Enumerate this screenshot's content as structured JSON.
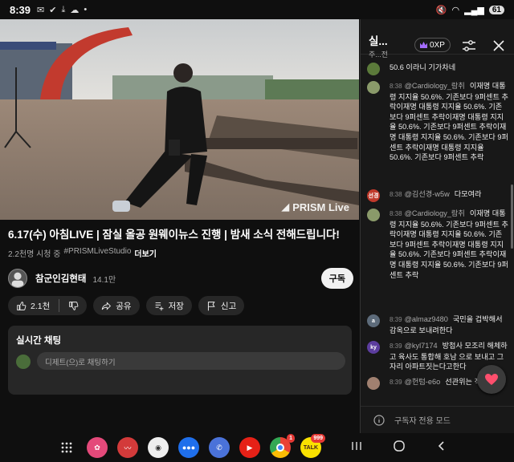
{
  "status_bar": {
    "time": "8:39",
    "battery": "61"
  },
  "video": {
    "watermark": "PRISM Live"
  },
  "video_info": {
    "title": "6.17(수) 아침LIVE | 잠실 올공 원웨이뉴스 진행 | 밤새 소식 전해드립니다!",
    "watching": "2.2천명 시청 중",
    "hashtag": "#PRISMLiveStudio",
    "more_label": "더보기"
  },
  "channel": {
    "name": "참군인김현태",
    "subscribers": "14.1만",
    "subscribe_label": "구독"
  },
  "actions": {
    "likes": "2.1천",
    "share": "공유",
    "save": "저장",
    "report": "신고"
  },
  "live_chat": {
    "label": "실시간 채팅",
    "placeholder": "디제트(으)로 채팅하기"
  },
  "chat_panel": {
    "title": "실...",
    "subtitle": "주...전",
    "xp": "0XP",
    "messages": [
      {
        "time": "",
        "user": "",
        "text": "50.6 이라니 기가차네",
        "avatar_color": "#5b7a3a",
        "avatar_text": ""
      },
      {
        "time": "8:38",
        "user": "@Cardiology_람취",
        "text": "이재명 대통령 지지율 50.6%. 기존보다 9퍼센트 추락이재명 대통령 지지율 50.6%. 기존보다 9퍼센트 추락이재명 대통령 지지율 50.6%. 기존보다 9퍼센트 추락이재명 대통령 지지율 50.6%. 기존보다 9퍼센트 추락이재명 대통령 지지율 50.6%. 기존보다 9퍼센트 추락",
        "avatar_color": "#8a9a6a",
        "avatar_text": ""
      },
      {
        "time": "8:38",
        "user": "@김선경-w5w",
        "text": "다모여라",
        "avatar_color": "#c0392b",
        "avatar_text": "선경"
      },
      {
        "time": "8:38",
        "user": "@Cardiology_람취",
        "text": "이재명 대통령 지지율 50.6%. 기존보다 9퍼센트 추락이재명 대통령 지지율 50.6%. 기존보다 9퍼센트 추락이재명 대통령 지지율 50.6%. 기존보다 9퍼센트 추락이재명 대통령 지지율 50.6%. 기존보다 9퍼센트 추락",
        "avatar_color": "#8a9a6a",
        "avatar_text": ""
      },
      {
        "time": "8:39",
        "user": "@almaz9480",
        "text": "국민을 겁박해서 감옥으로 보내려한다",
        "avatar_color": "#5d6b7a",
        "avatar_text": "a"
      },
      {
        "time": "8:39",
        "user": "@kyl7174",
        "text": "방첩사 모조리 해체하고 육사도 통합해 호남 으로 보내고 그자리 아파트짓는다고한다",
        "avatar_color": "#5c3d9e",
        "avatar_text": "ky"
      },
      {
        "time": "8:39",
        "user": "@헌텀-e6o",
        "text": "선관위는 적입니다",
        "avatar_color": "#a08070",
        "avatar_text": ""
      }
    ],
    "footer": "구독자 전용 모드"
  },
  "dock": {
    "chrome_badge": "1",
    "talk_badge": "999",
    "talk_label": "TALK"
  }
}
